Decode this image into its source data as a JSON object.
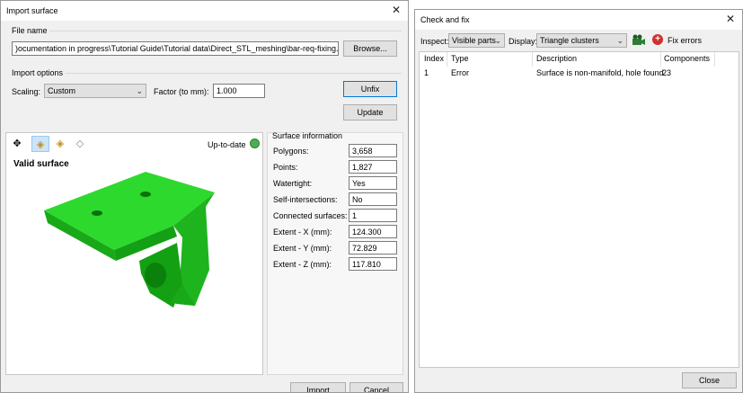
{
  "import_dialog": {
    "title": "Import surface",
    "file_name_label": "File name",
    "file_path": ")ocumentation in progress\\Tutorial Guide\\Tutorial data\\Direct_STL_meshing\\bar-req-fixing.stl",
    "browse_label": "Browse...",
    "import_options_label": "Import options",
    "scaling_label": "Scaling:",
    "scaling_value": "Custom",
    "factor_label": "Factor (to mm):",
    "factor_value": "1.000",
    "unfix_label": "Unfix",
    "update_label": "Update",
    "status_label": "Up-to-date",
    "viewport_title": "Valid surface",
    "surface_info_label": "Surface information",
    "info": [
      {
        "label": "Polygons:",
        "value": "3,658"
      },
      {
        "label": "Points:",
        "value": "1,827"
      },
      {
        "label": "Watertight:",
        "value": "Yes"
      },
      {
        "label": "Self-intersections:",
        "value": "No"
      },
      {
        "label": "Connected surfaces:",
        "value": "1"
      },
      {
        "label": "Extent - X (mm):",
        "value": "124.300"
      },
      {
        "label": "Extent - Y (mm):",
        "value": "72.829"
      },
      {
        "label": "Extent - Z (mm):",
        "value": "117.810"
      }
    ],
    "import_label": "Import",
    "cancel_label": "Cancel",
    "colors": {
      "surface": "#22cc22",
      "status_ok": "#4caf50"
    }
  },
  "check_dialog": {
    "title": "Check and fix",
    "inspect_label": "Inspect:",
    "inspect_value": "Visible parts",
    "display_label": "Display:",
    "display_value": "Triangle clusters",
    "fix_errors_label": "Fix errors",
    "columns": [
      "Index",
      "Type",
      "Description",
      "Components"
    ],
    "rows": [
      {
        "index": "1",
        "type": "Error",
        "description": "Surface is non-manifold, hole found.",
        "components": "23"
      }
    ],
    "close_label": "Close"
  }
}
